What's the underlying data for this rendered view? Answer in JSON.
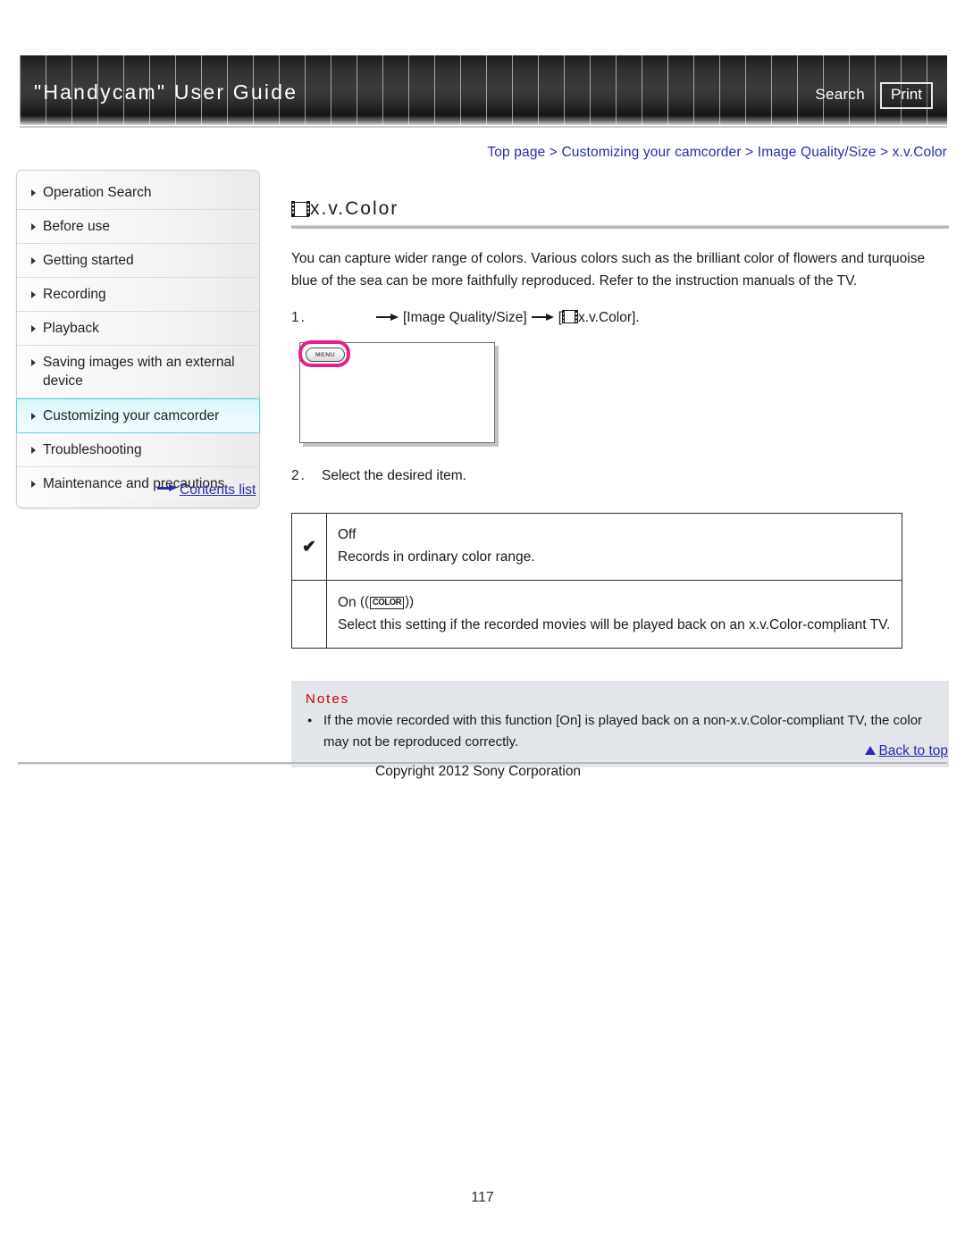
{
  "header": {
    "site_title": "\"Handycam\" User Guide",
    "search_label": "Search",
    "print_label": "Print"
  },
  "breadcrumb": {
    "text": "Top page > Customizing your camcorder > Image Quality/Size > x.v.Color"
  },
  "sidebar": {
    "items": [
      {
        "label": "Operation Search",
        "active": false
      },
      {
        "label": "Before use",
        "active": false
      },
      {
        "label": "Getting started",
        "active": false
      },
      {
        "label": "Recording",
        "active": false
      },
      {
        "label": "Playback",
        "active": false
      },
      {
        "label": "Saving images with an external device",
        "active": false
      },
      {
        "label": "Customizing your camcorder",
        "active": true
      },
      {
        "label": "Troubleshooting",
        "active": false
      },
      {
        "label": "Maintenance and precautions",
        "active": false
      }
    ],
    "contents_list_label": "Contents list"
  },
  "main": {
    "page_title": "x.v.Color",
    "intro": "You can capture wider range of colors. Various colors such as the brilliant color of flowers and turquoise blue of the sea can be more faithfully reproduced. Refer to the instruction manuals of the TV.",
    "step1": {
      "number": "1.",
      "part1": "[Image Quality/Size]",
      "part2_prefix": "[",
      "part2_text": "x.v.Color].",
      "menu_button_label": "MENU"
    },
    "step2": {
      "number": "2.",
      "text": "Select the desired item."
    },
    "options": [
      {
        "checked": true,
        "check_glyph": "✔",
        "label": "Off",
        "badge": "",
        "description": "Records in ordinary color range."
      },
      {
        "checked": false,
        "check_glyph": "",
        "label": "On",
        "badge": "COLOR",
        "description": "Select this setting if the recorded movies will be played back on an x.v.Color-compliant TV."
      }
    ],
    "notes": {
      "title": "Notes",
      "items": [
        "If the movie recorded with this function [On] is played back on a non-x.v.Color-compliant TV, the color may not be reproduced correctly."
      ]
    },
    "back_to_top_label": "Back to top"
  },
  "footer": {
    "copyright": "Copyright 2012 Sony Corporation",
    "page_number": "117"
  },
  "colors": {
    "link": "#2a2ab0",
    "notes_title": "#cc0000",
    "highlight_border": "#63d3e4",
    "notes_bg": "#e2e6ea",
    "menu_highlight": "#ea1e8c"
  }
}
